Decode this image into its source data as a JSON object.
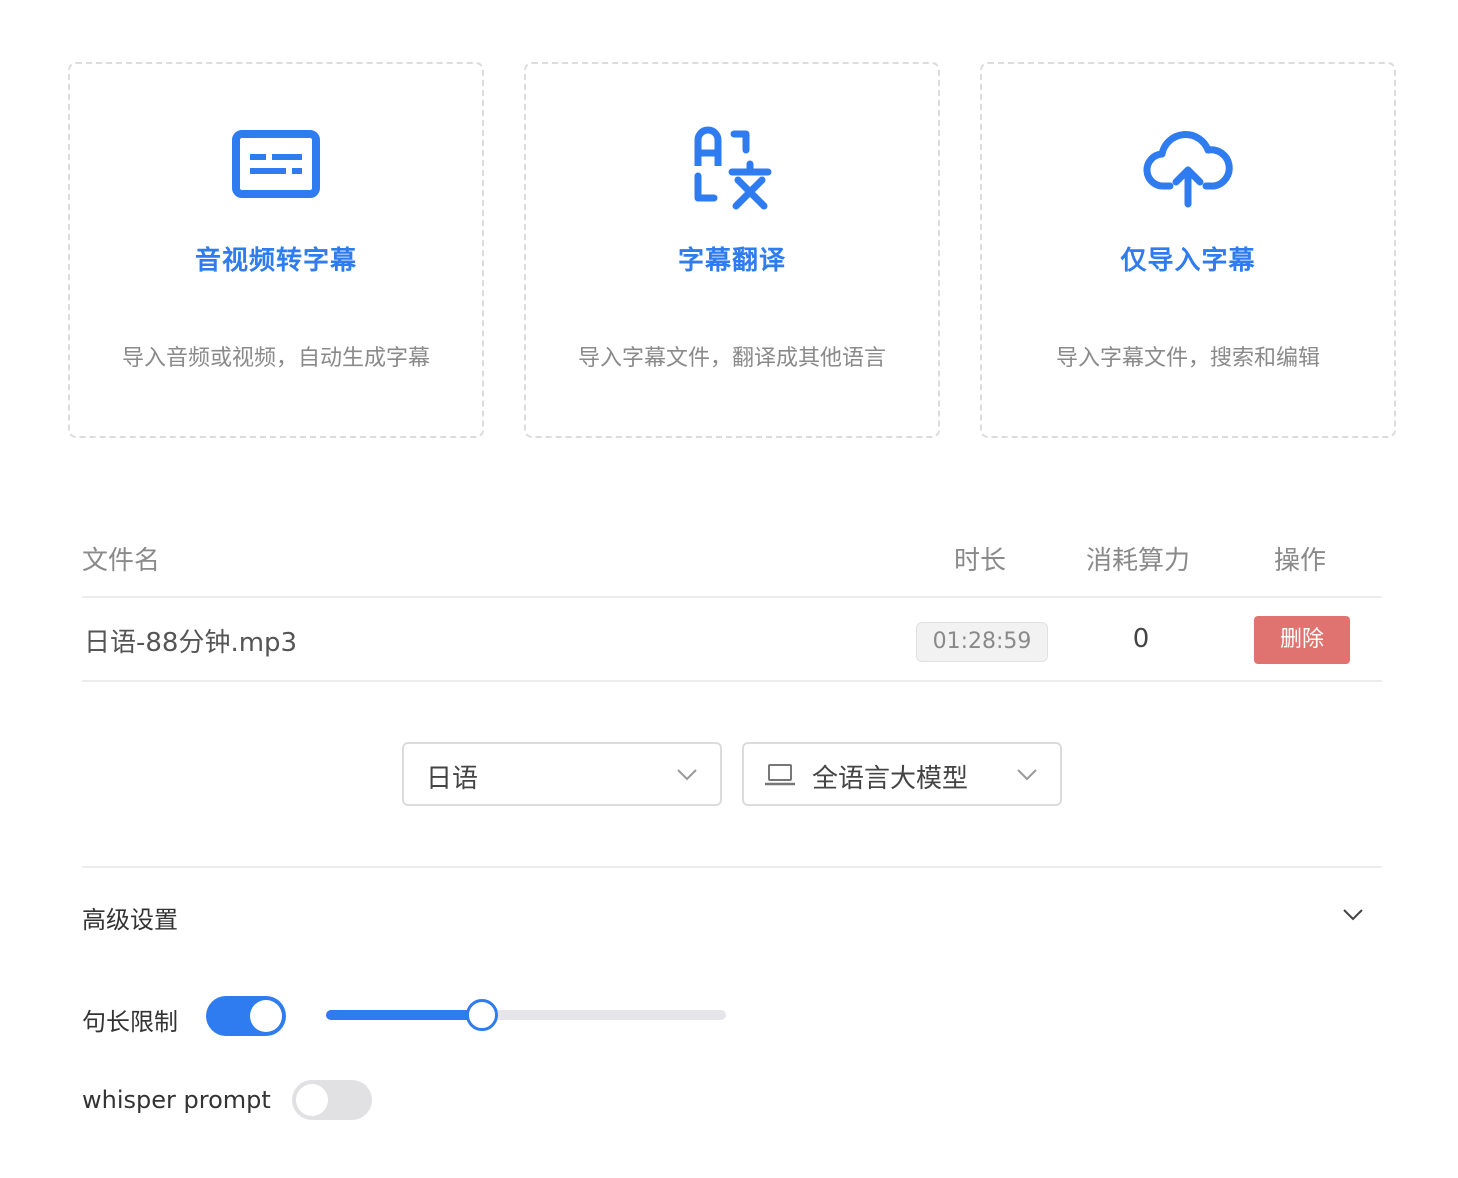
{
  "cards": [
    {
      "title": "音视频转字幕",
      "desc": "导入音频或视频，自动生成字幕",
      "icon": "subtitles-icon"
    },
    {
      "title": "字幕翻译",
      "desc": "导入字幕文件，翻译成其他语言",
      "icon": "translate-icon"
    },
    {
      "title": "仅导入字幕",
      "desc": "导入字幕文件，搜索和编辑",
      "icon": "cloud-upload-icon"
    }
  ],
  "table": {
    "headers": {
      "name": "文件名",
      "duration": "时长",
      "cost": "消耗算力",
      "action": "操作"
    },
    "rows": [
      {
        "name": "日语-88分钟.mp3",
        "duration": "01:28:59",
        "cost": "0",
        "action": "删除"
      }
    ]
  },
  "selects": {
    "language": {
      "value": "日语"
    },
    "model": {
      "value": "全语言大模型",
      "icon": "laptop-icon"
    }
  },
  "advanced": {
    "title": "高级设置",
    "sentence_limit": {
      "label": "句长限制",
      "enabled": true,
      "slider_fraction": 0.39
    },
    "whisper_prompt": {
      "label": "whisper prompt",
      "enabled": false
    }
  },
  "colors": {
    "accent": "#2f7bf0",
    "danger": "#e07370",
    "muted_text": "#8a8a8a",
    "border": "#dcdcdc"
  }
}
